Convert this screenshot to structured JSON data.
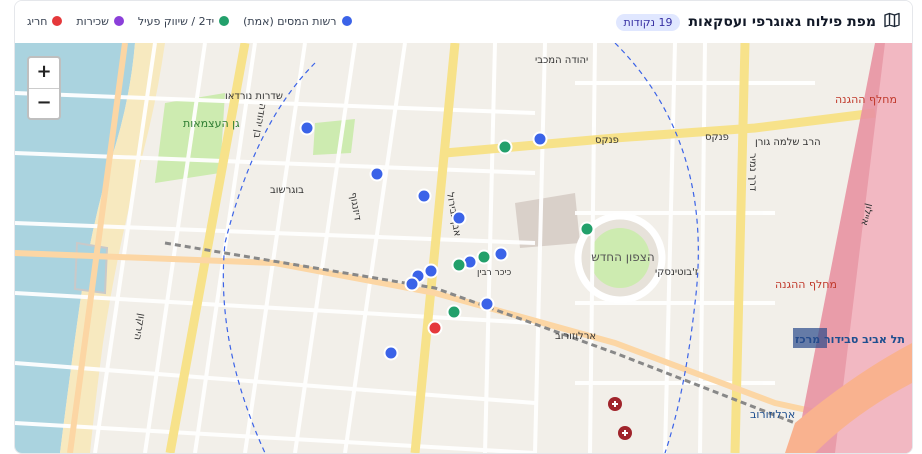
{
  "header": {
    "title": "מפת פילוח גאוגרפי ועסקאות",
    "count_badge": "19 נקודות",
    "map_icon": "map-icon"
  },
  "legend": [
    {
      "label": "רשות המסים (אמת)",
      "color": "#3b63e8"
    },
    {
      "label": "יד2 / שיווק פעיל",
      "color": "#22a06b"
    },
    {
      "label": "שכירות",
      "color": "#8b3fd9"
    },
    {
      "label": "חריג",
      "color": "#e5383b"
    }
  ],
  "zoom": {
    "in_label": "+",
    "out_label": "−"
  },
  "map_labels": {
    "park": "גן העצמאות",
    "square": "הצפון החדש",
    "street_pinkas": "פנקס",
    "street_arlozorov": "ארלוזורוב",
    "street_nordau": "שדרות נורדאו",
    "street_bugrashov": "בוגרשוב",
    "street_dizengoff": "דיזנגוף",
    "street_ibn_gvirol": "אבן גבירול",
    "street_yehuda_maccabi": "יהודה המכבי",
    "street_namir": "דרך נמיר",
    "street_jabotinsky": "ז'בוטינסקי",
    "street_ben_yehuda": "בן יהודה",
    "street_hayarkon": "הירקון",
    "street_shlomo_goren": "הרב שלמה גורן",
    "street_ayalon": "איילון",
    "station_savidor": "תל אביב סבידור מרכז",
    "station_hahagana": "מחלף ההגנה",
    "block": "כיכר רבין"
  }
}
